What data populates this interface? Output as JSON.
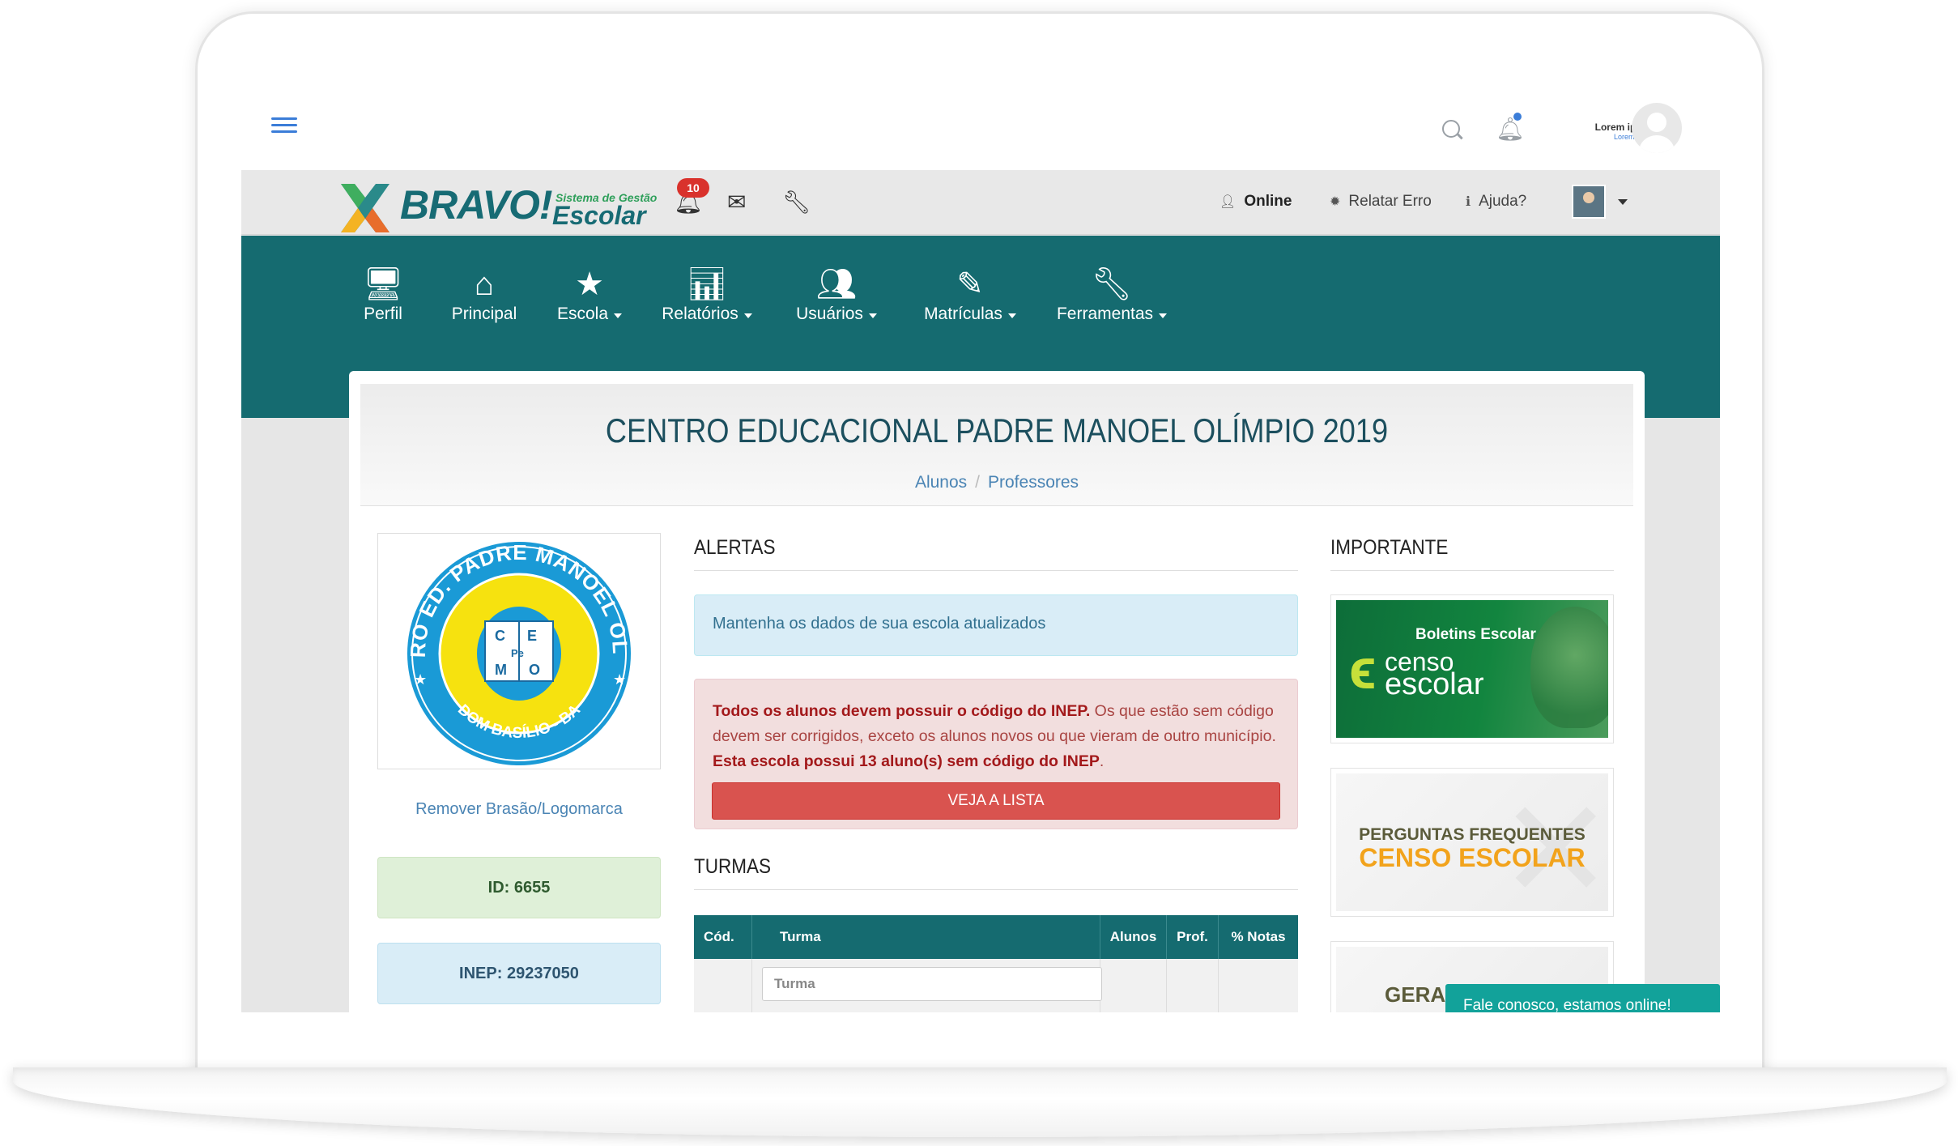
{
  "device_top": {
    "user_name": "Lorem ipsum",
    "user_role": "Lorem ipsum"
  },
  "header": {
    "brand": "BRAVO!",
    "brand_sub1": "Sistema de Gestão",
    "brand_sub2": "Escolar",
    "notifications_count": "10",
    "online_label": "Online",
    "report_error_label": "Relatar Erro",
    "help_label": "Ajuda?"
  },
  "nav": {
    "items": [
      {
        "label": "Perfil",
        "icon": "monitor-icon",
        "dropdown": false
      },
      {
        "label": "Principal",
        "icon": "home-icon",
        "dropdown": false
      },
      {
        "label": "Escola",
        "icon": "star-icon",
        "dropdown": true
      },
      {
        "label": "Relatórios",
        "icon": "bar-chart-icon",
        "dropdown": true
      },
      {
        "label": "Usuários",
        "icon": "users-icon",
        "dropdown": true
      },
      {
        "label": "Matrículas",
        "icon": "edit-icon",
        "dropdown": true
      },
      {
        "label": "Ferramentas",
        "icon": "wrench-icon",
        "dropdown": true
      }
    ]
  },
  "page": {
    "title": "CENTRO EDUCACIONAL PADRE MANOEL OLÍMPIO 2019",
    "breadcrumbs": [
      "Alunos",
      "Professores"
    ]
  },
  "school": {
    "remove_logo_label": "Remover Brasão/Logomarca",
    "id_label": "ID: 6655",
    "inep_label": "INEP: 29237050",
    "seal_top_text": "CENTRO ED. PADRE MANOEL OLIMPIO",
    "seal_bottom_text": "DOM BASÍLIO - BA",
    "seal_letters": [
      "C",
      "E",
      "Pe",
      "M",
      "O"
    ]
  },
  "alerts": {
    "heading": "ALERTAS",
    "info_text": "Mantenha os dados de sua escola atualizados",
    "danger_bold_1": "Todos os alunos devem possuir o código do INEP.",
    "danger_text": " Os que estão sem código devem ser corrigidos, exceto os alunos novos ou que vieram de outro município. ",
    "danger_bold_2": "Esta escola possui 13 aluno(s) sem código do INEP",
    "danger_end": ".",
    "button_label": "VEJA A LISTA"
  },
  "turmas": {
    "heading": "TURMAS",
    "columns": [
      "Cód.",
      "Turma",
      "Alunos",
      "Prof.",
      "% Notas"
    ],
    "filter_placeholder": "Turma"
  },
  "importante": {
    "heading": "IMPORTANTE",
    "banner1_title": "Boletins Escolar",
    "banner1_logo_line1": "censo",
    "banner1_logo_line2": "escolar",
    "banner2_line1": "PERGUNTAS FREQUENTES",
    "banner2_line2": "CENSO ESCOLAR",
    "banner3_text": "GERA"
  },
  "chat": {
    "label": "Fale conosco, estamos online!"
  },
  "colors": {
    "nav_bg": "#156b70",
    "title": "#1c4f5e",
    "link": "#4a84b4",
    "danger": "#d9534f",
    "chat": "#12a29a"
  }
}
